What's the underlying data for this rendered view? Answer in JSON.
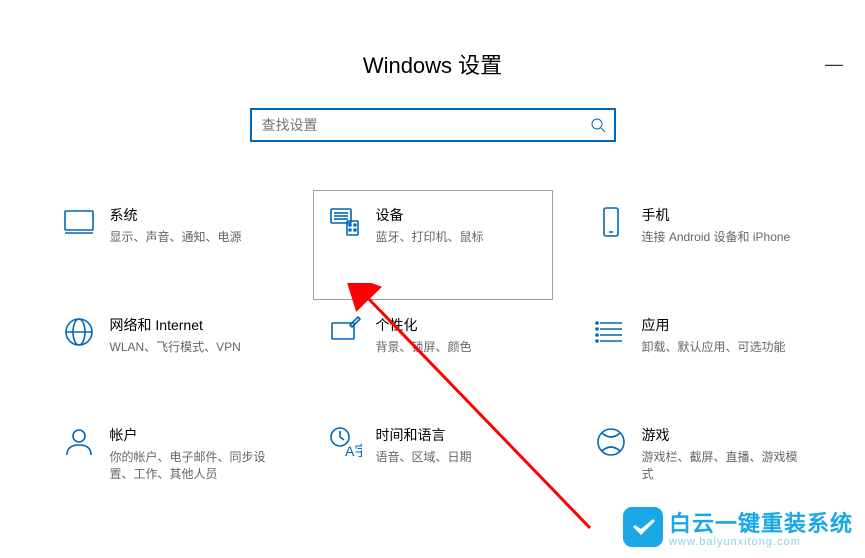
{
  "title": "Windows 设置",
  "search": {
    "placeholder": "查找设置"
  },
  "tiles": [
    {
      "title": "系统",
      "sub": "显示、声音、通知、电源"
    },
    {
      "title": "设备",
      "sub": "蓝牙、打印机、鼠标"
    },
    {
      "title": "手机",
      "sub": "连接 Android 设备和 iPhone"
    },
    {
      "title": "网络和 Internet",
      "sub": "WLAN、飞行模式、VPN"
    },
    {
      "title": "个性化",
      "sub": "背景、锁屏、颜色"
    },
    {
      "title": "应用",
      "sub": "卸载、默认应用、可选功能"
    },
    {
      "title": "帐户",
      "sub": "你的帐户、电子邮件、同步设置、工作、其他人员"
    },
    {
      "title": "时间和语言",
      "sub": "语音、区域、日期"
    },
    {
      "title": "游戏",
      "sub": "游戏栏、截屏、直播、游戏模式"
    }
  ],
  "watermark": {
    "line1": "白云一键重装系统",
    "line2": "www.baiyunxitong.com"
  },
  "colors": {
    "accent": "#0067b8",
    "arrow": "#ff0000",
    "brand": "#19a7e6"
  }
}
